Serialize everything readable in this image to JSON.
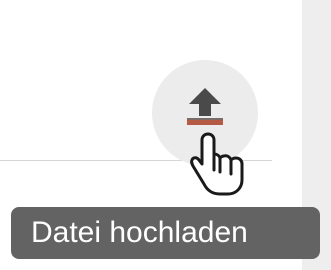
{
  "upload_button": {
    "icon": "upload-arrow-icon",
    "icon_color": "#4a4a4a",
    "accent_color": "#b45a45"
  },
  "cursor": {
    "icon": "hand-pointer-icon"
  },
  "tooltip": {
    "text": "Datei hochladen",
    "background": "#636363",
    "color": "#ffffff"
  }
}
